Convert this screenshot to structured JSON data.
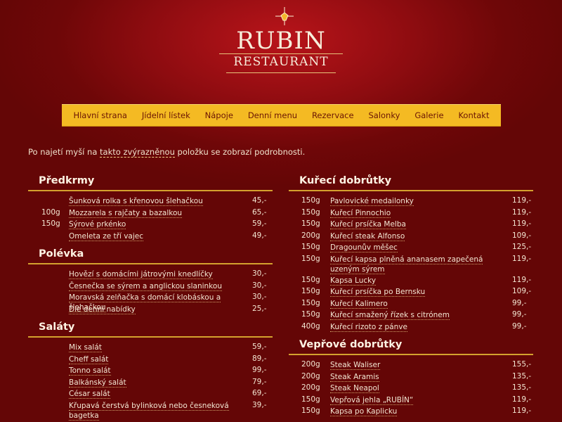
{
  "logo": {
    "name": "RUBIN",
    "sub": "RESTAURANT"
  },
  "nav": [
    "Hlavní strana",
    "Jídelní lístek",
    "Nápoje",
    "Denní menu",
    "Rezervace",
    "Salonky",
    "Galerie",
    "Kontakt"
  ],
  "hint": {
    "pre": "Po najetí myší na ",
    "highlight": "takto zvýrazněnou",
    "post": " položku se zobrazí podrobnosti."
  },
  "left": [
    {
      "title": "Předkrmy",
      "items": [
        {
          "w": "",
          "name": "Šunková rolka s křenovou šlehačkou",
          "price": "45,-"
        },
        {
          "w": "100g",
          "name": "Mozzarela s rajčaty a bazalkou",
          "price": "65,-"
        },
        {
          "w": "150g",
          "name": "Sýrové prkénko",
          "price": "59,-"
        },
        {
          "w": "",
          "name": "Omeleta ze tří vajec",
          "price": "49,-"
        }
      ]
    },
    {
      "title": "Polévka",
      "items": [
        {
          "w": "",
          "name": "Hovězí s domácími játrovými knedlíčky",
          "price": "30,-"
        },
        {
          "w": "",
          "name": "Česnečka se sýrem a anglickou slaninkou",
          "price": "30,-"
        },
        {
          "w": "",
          "name": "Moravská zelňačka s domácí klobáskou a šlehačkou",
          "price": "30,-"
        },
        {
          "w": "",
          "name": "Dle denní nabídky",
          "price": "25,-"
        }
      ]
    },
    {
      "title": "Saláty",
      "items": [
        {
          "w": "",
          "name": "Mix salát",
          "price": "59,-"
        },
        {
          "w": "",
          "name": "Cheff salát",
          "price": "89,-"
        },
        {
          "w": "",
          "name": "Tonno salát",
          "price": "99,-"
        },
        {
          "w": "",
          "name": "Balkánský salát",
          "price": "79,-"
        },
        {
          "w": "",
          "name": "César salát",
          "price": "69,-"
        },
        {
          "w": "",
          "name": "Křupavá čerstvá bylinková nebo česneková bagetka",
          "price": "39,-"
        }
      ]
    }
  ],
  "right": [
    {
      "title": "Kuřecí dobrůtky",
      "items": [
        {
          "w": "150g",
          "name": "Pavlovické medailonky",
          "price": "119,-"
        },
        {
          "w": "150g",
          "name": "Kuřecí Pinnochio",
          "price": "119,-"
        },
        {
          "w": "150g",
          "name": "Kuřecí prsíčka Melba",
          "price": "119,-"
        },
        {
          "w": "200g",
          "name": "Kuřecí steak Alfonso",
          "price": "109,-"
        },
        {
          "w": "150g",
          "name": "Dragounův měšec",
          "price": "125,-"
        },
        {
          "w": "150g",
          "name": "Kuřecí kapsa plněná ananasem zapečená uzeným sýrem",
          "price": "119,-"
        },
        {
          "w": "150g",
          "name": "Kapsa Lucky",
          "price": "119,-"
        },
        {
          "w": "150g",
          "name": "Kuřecí prsíčka po Bernsku",
          "price": "109,-"
        },
        {
          "w": "150g",
          "name": "Kuřecí Kalimero",
          "price": "99,-"
        },
        {
          "w": "150g",
          "name": "Kuřecí smažený řízek s citrónem",
          "price": "99,-"
        },
        {
          "w": "400g",
          "name": "Kuřecí rizoto z pánve",
          "price": "99,-"
        }
      ]
    },
    {
      "title": "Vepřové dobrůtky",
      "items": [
        {
          "w": "200g",
          "name": "Steak Waliser",
          "price": "155,-"
        },
        {
          "w": "200g",
          "name": "Steak Aramis",
          "price": "135,-"
        },
        {
          "w": "200g",
          "name": "Steak Neapol",
          "price": "135,-"
        },
        {
          "w": "150g",
          "name": "Vepřová jehla „RUBÍN“",
          "price": "119,-"
        },
        {
          "w": "150g",
          "name": "Kapsa po Kaplicku",
          "price": "119,-"
        }
      ]
    }
  ]
}
